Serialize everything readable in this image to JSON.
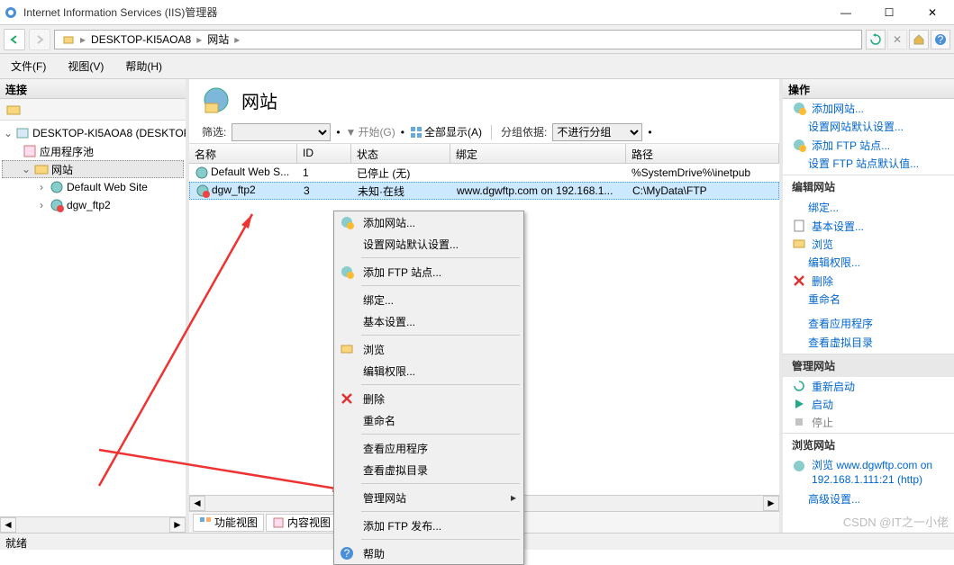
{
  "window": {
    "title": "Internet Information Services (IIS)管理器"
  },
  "breadcrumb": {
    "host": "DESKTOP-KI5AOA8",
    "node": "网站"
  },
  "menus": {
    "file": "文件(F)",
    "view": "视图(V)",
    "help": "帮助(H)"
  },
  "left": {
    "header": "连接",
    "tree": {
      "root": "DESKTOP-KI5AOA8 (DESKTOP",
      "pools": "应用程序池",
      "sites": "网站",
      "site1": "Default Web Site",
      "site2": "dgw_ftp2"
    }
  },
  "center": {
    "title": "网站",
    "filter_label": "筛选:",
    "start_label": "开始(G)",
    "show_all": "全部显示(A)",
    "group_label": "分组依据:",
    "group_value": "不进行分组",
    "columns": {
      "name": "名称",
      "id": "ID",
      "status": "状态",
      "bind": "绑定",
      "path": "路径"
    },
    "rows": [
      {
        "name": "Default Web S...",
        "id": "1",
        "status": "已停止 (无)",
        "bind": "",
        "path": "%SystemDrive%\\inetpub"
      },
      {
        "name": "dgw_ftp2",
        "id": "3",
        "status": "未知·在线",
        "bind": "www.dgwftp.com on 192.168.1...",
        "path": "C:\\MyData\\FTP"
      }
    ],
    "tabs": {
      "features": "功能视图",
      "content": "内容视图"
    }
  },
  "context": {
    "add_site": "添加网站...",
    "site_defaults": "设置网站默认设置...",
    "add_ftp": "添加 FTP 站点...",
    "bindings": "绑定...",
    "basic": "基本设置...",
    "browse": "浏览",
    "edit_perm": "编辑权限...",
    "delete": "删除",
    "rename": "重命名",
    "view_apps": "查看应用程序",
    "view_vdirs": "查看虚拟目录",
    "manage": "管理网站",
    "add_ftp_pub": "添加 FTP 发布...",
    "help": "帮助"
  },
  "right": {
    "header": "操作",
    "add_site": "添加网站...",
    "site_defaults": "设置网站默认设置...",
    "add_ftp": "添加 FTP 站点...",
    "ftp_defaults": "设置 FTP 站点默认值...",
    "edit_section": "编辑网站",
    "bindings": "绑定...",
    "basic": "基本设置...",
    "browse": "浏览",
    "edit_perm": "编辑权限...",
    "delete": "删除",
    "rename": "重命名",
    "view_apps": "查看应用程序",
    "view_vdirs": "查看虚拟目录",
    "manage_section": "管理网站",
    "restart": "重新启动",
    "start": "启动",
    "stop": "停止",
    "browse_section": "浏览网站",
    "browse_url": "浏览 www.dgwftp.com on 192.168.1.111:21 (http)",
    "advanced": "高级设置..."
  },
  "status": "就绪",
  "watermark": "CSDN @IT之一小佬"
}
